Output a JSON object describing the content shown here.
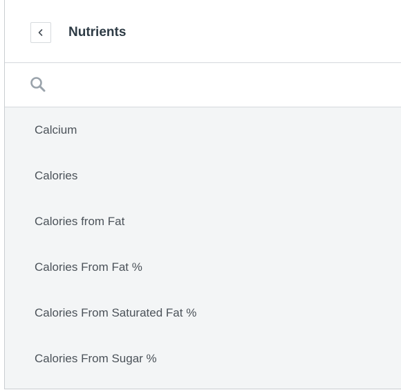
{
  "header": {
    "title": "Nutrients",
    "back_icon": "chevron-left-icon"
  },
  "search": {
    "icon": "search-icon",
    "value": "",
    "placeholder": ""
  },
  "list": {
    "items": [
      {
        "label": "Calcium"
      },
      {
        "label": "Calories"
      },
      {
        "label": "Calories from Fat"
      },
      {
        "label": "Calories From Fat %"
      },
      {
        "label": "Calories From Saturated Fat %"
      },
      {
        "label": "Calories From Sugar %"
      }
    ]
  },
  "colors": {
    "title": "#2e3b45",
    "list_background": "#f3f5f6",
    "item_text": "#4b5259",
    "search_icon": "#9aa3ab"
  }
}
